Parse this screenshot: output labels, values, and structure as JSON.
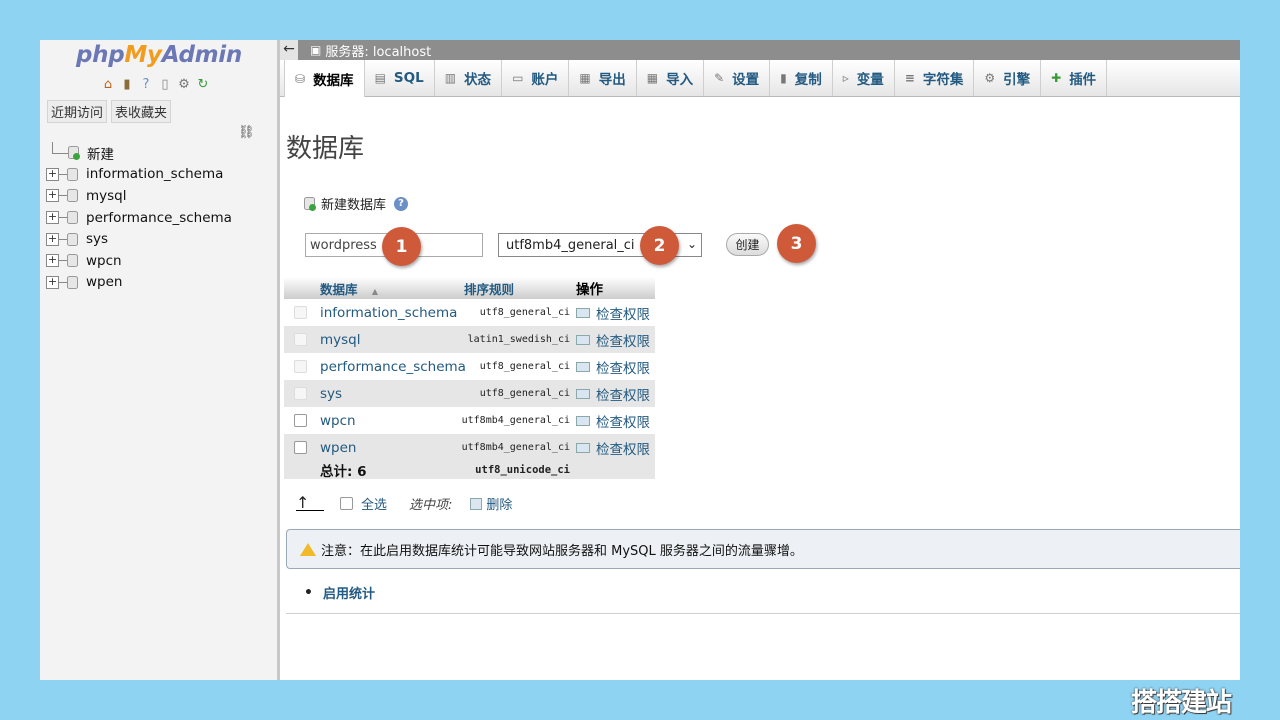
{
  "nav": {
    "logo": {
      "php": "php",
      "my": "My",
      "admin": "Admin"
    },
    "tabs": [
      "近期访问",
      "表收藏夹"
    ],
    "tree": [
      {
        "label": "新建",
        "type": "new"
      },
      {
        "label": "information_schema"
      },
      {
        "label": "mysql"
      },
      {
        "label": "performance_schema"
      },
      {
        "label": "sys"
      },
      {
        "label": "wpcn"
      },
      {
        "label": "wpen"
      }
    ]
  },
  "serverbar": {
    "label": "服务器: localhost"
  },
  "tabs": [
    "数据库",
    "SQL",
    "状态",
    "账户",
    "导出",
    "导入",
    "设置",
    "复制",
    "变量",
    "字符集",
    "引擎",
    "插件"
  ],
  "main": {
    "title": "数据库",
    "create_label": "新建数据库",
    "dbname_value": "wordpress",
    "collation_value": "utf8mb4_general_ci",
    "create_button": "创建",
    "steps": [
      "1",
      "2",
      "3"
    ]
  },
  "table": {
    "headers": {
      "db": "数据库",
      "sort_arrow": "▲",
      "collation": "排序规则",
      "action": "操作"
    },
    "rows": [
      {
        "db": "information_schema",
        "collation": "utf8_general_ci",
        "action": "检查权限",
        "checkbox_enabled": false
      },
      {
        "db": "mysql",
        "collation": "latin1_swedish_ci",
        "action": "检查权限",
        "checkbox_enabled": false
      },
      {
        "db": "performance_schema",
        "collation": "utf8_general_ci",
        "action": "检查权限",
        "checkbox_enabled": false
      },
      {
        "db": "sys",
        "collation": "utf8_general_ci",
        "action": "检查权限",
        "checkbox_enabled": false
      },
      {
        "db": "wpcn",
        "collation": "utf8mb4_general_ci",
        "action": "检查权限",
        "checkbox_enabled": true
      },
      {
        "db": "wpen",
        "collation": "utf8mb4_general_ci",
        "action": "检查权限",
        "checkbox_enabled": true
      }
    ],
    "footer": {
      "total": "总计: 6",
      "collation": "utf8_unicode_ci"
    }
  },
  "bulk": {
    "select_all": "全选",
    "with_selected": "选中项:",
    "drop": "删除"
  },
  "notice": {
    "text": "注意：在此启用数据库统计可能导致网站服务器和 MySQL 服务器之间的流量骤增。"
  },
  "enable_stats": "启用统计",
  "watermark": "搭搭建站",
  "colors": {
    "link": "#235a81",
    "step_badge": "#cf5a3a",
    "background": "#8fd3f2"
  }
}
